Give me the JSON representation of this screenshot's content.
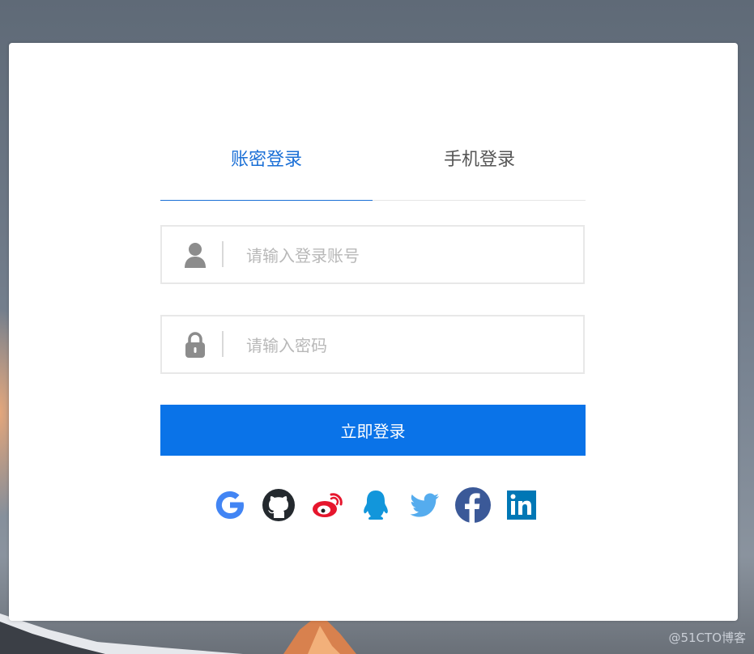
{
  "tabs": {
    "account": "账密登录",
    "phone": "手机登录"
  },
  "username": {
    "placeholder": "请输入登录账号",
    "value": ""
  },
  "password": {
    "placeholder": "请输入密码",
    "value": ""
  },
  "login_button": "立即登录",
  "social_logins": [
    "google-icon",
    "github-icon",
    "weibo-icon",
    "qq-icon",
    "twitter-icon",
    "facebook-icon",
    "linkedin-icon"
  ],
  "watermark": "@51CTO博客",
  "colors": {
    "accent": "#0a73e8",
    "tab_active": "#1a6fd6"
  }
}
